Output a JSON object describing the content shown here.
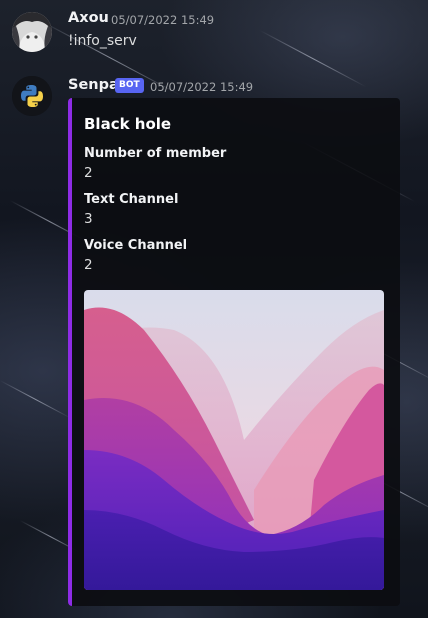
{
  "messages": [
    {
      "author": "Axou",
      "timestamp": "05/07/2022 15:49",
      "text": "!info_serv"
    },
    {
      "author": "Senpa",
      "badge": "BOT",
      "timestamp": "05/07/2022 15:49",
      "embed": {
        "accent_color": "#8e2ce6",
        "title": "Black hole",
        "fields": [
          {
            "name": "Number of member",
            "value": "2"
          },
          {
            "name": "Text Channel",
            "value": "3"
          },
          {
            "name": "Voice Channel",
            "value": "2"
          }
        ],
        "image": "purple-mountain-wallpaper"
      }
    }
  ],
  "icons": {
    "avatar_1": "anime-avatar",
    "avatar_2": "python-logo-icon"
  },
  "colors": {
    "bot_badge": "#5865f2",
    "embed_accent": "#8e2ce6"
  }
}
